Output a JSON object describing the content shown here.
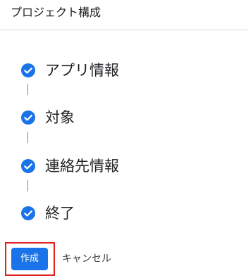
{
  "header": {
    "title": "プロジェクト構成"
  },
  "steps": [
    {
      "label": "アプリ情報",
      "status": "complete"
    },
    {
      "label": "対象",
      "status": "complete"
    },
    {
      "label": "連絡先情報",
      "status": "complete"
    },
    {
      "label": "終了",
      "status": "complete"
    }
  ],
  "actions": {
    "create_label": "作成",
    "cancel_label": "キャンセル"
  },
  "colors": {
    "accent": "#1a73e8",
    "highlight": "#e01f1f",
    "divider": "#dadce0"
  }
}
